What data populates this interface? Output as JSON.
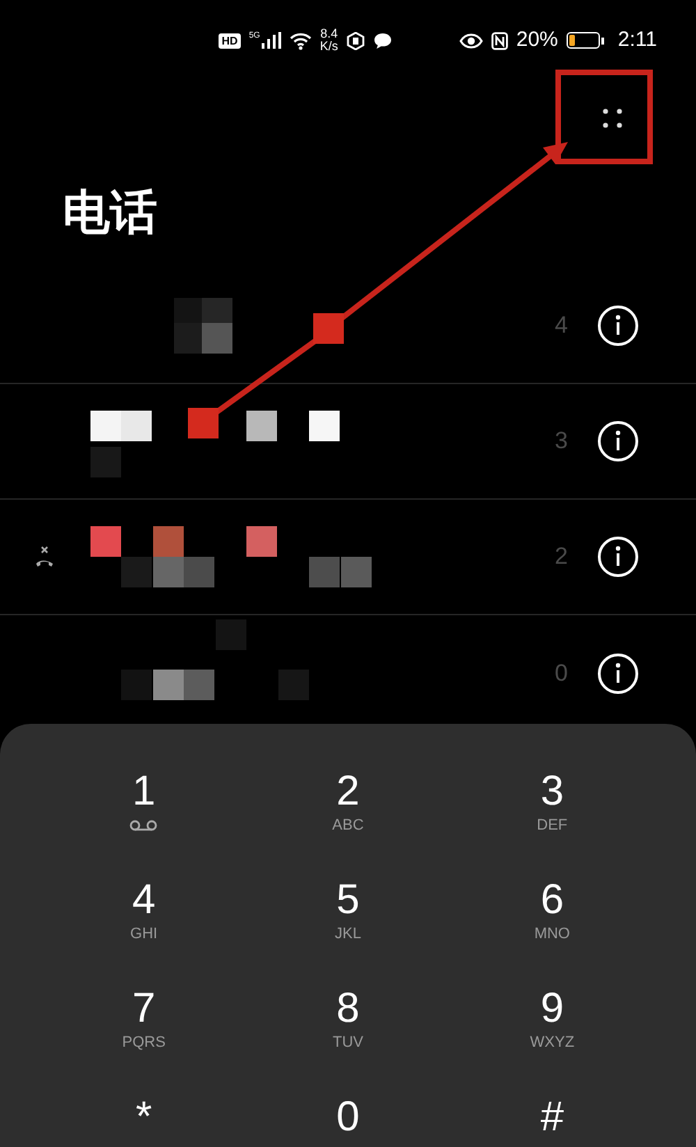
{
  "status_bar": {
    "network_badge": "HD",
    "network_type": "5G",
    "speed_value": "8.4",
    "speed_unit": "K/s",
    "battery_percent": "20%",
    "time": "2:11"
  },
  "title": "电话",
  "calls": [
    {
      "count": "4",
      "missed": false
    },
    {
      "count": "3",
      "missed": false
    },
    {
      "count": "2",
      "missed": true
    },
    {
      "count": "0",
      "missed": false
    }
  ],
  "keypad": [
    {
      "digit": "1",
      "kind": "voicemail"
    },
    {
      "digit": "2",
      "letters": "ABC",
      "kind": "letters"
    },
    {
      "digit": "3",
      "letters": "DEF",
      "kind": "letters"
    },
    {
      "digit": "4",
      "letters": "GHI",
      "kind": "letters"
    },
    {
      "digit": "5",
      "letters": "JKL",
      "kind": "letters"
    },
    {
      "digit": "6",
      "letters": "MNO",
      "kind": "letters"
    },
    {
      "digit": "7",
      "letters": "PQRS",
      "kind": "letters"
    },
    {
      "digit": "8",
      "letters": "TUV",
      "kind": "letters"
    },
    {
      "digit": "9",
      "letters": "WXYZ",
      "kind": "letters"
    },
    {
      "digit": "*",
      "kind": "plain"
    },
    {
      "digit": "0",
      "kind": "plain"
    },
    {
      "digit": "#",
      "kind": "plain"
    }
  ]
}
